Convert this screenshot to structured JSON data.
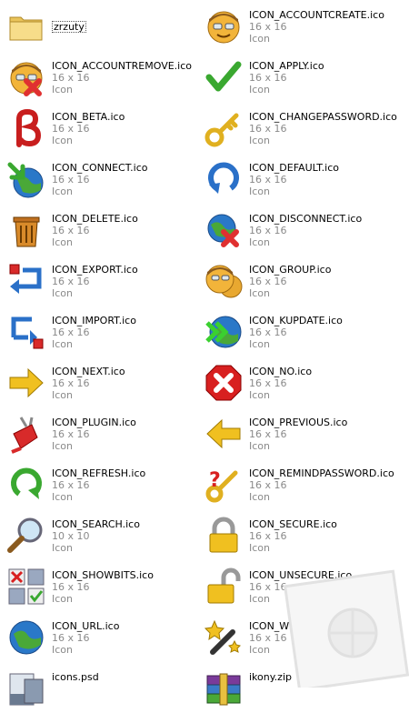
{
  "folder": {
    "name": "zrzuty"
  },
  "items": [
    {
      "name": "ICON_ACCOUNTCREATE.ico",
      "size": "16 x 16",
      "type": "Icon",
      "icon": "account-face-icon"
    },
    {
      "name": "ICON_ACCOUNTREMOVE.ico",
      "size": "16 x 16",
      "type": "Icon",
      "icon": "account-remove-icon"
    },
    {
      "name": "ICON_APPLY.ico",
      "size": "16 x 16",
      "type": "Icon",
      "icon": "checkmark-icon"
    },
    {
      "name": "ICON_BETA.ico",
      "size": "16 x 16",
      "type": "Icon",
      "icon": "beta-icon"
    },
    {
      "name": "ICON_CHANGEPASSWORD.ico",
      "size": "16 x 16",
      "type": "Icon",
      "icon": "key-icon"
    },
    {
      "name": "ICON_CONNECT.ico",
      "size": "16 x 16",
      "type": "Icon",
      "icon": "globe-connect-icon"
    },
    {
      "name": "ICON_DEFAULT.ico",
      "size": "16 x 16",
      "type": "Icon",
      "icon": "circular-arrow-icon"
    },
    {
      "name": "ICON_DELETE.ico",
      "size": "16 x 16",
      "type": "Icon",
      "icon": "trash-can-icon"
    },
    {
      "name": "ICON_DISCONNECT.ico",
      "size": "16 x 16",
      "type": "Icon",
      "icon": "globe-disconnect-icon"
    },
    {
      "name": "ICON_EXPORT.ico",
      "size": "16 x 16",
      "type": "Icon",
      "icon": "export-arrow-icon"
    },
    {
      "name": "ICON_GROUP.ico",
      "size": "16 x 16",
      "type": "Icon",
      "icon": "group-faces-icon"
    },
    {
      "name": "ICON_IMPORT.ico",
      "size": "16 x 16",
      "type": "Icon",
      "icon": "import-arrow-icon"
    },
    {
      "name": "ICON_KUPDATE.ico",
      "size": "16 x 16",
      "type": "Icon",
      "icon": "globe-fast-forward-icon"
    },
    {
      "name": "ICON_NEXT.ico",
      "size": "16 x 16",
      "type": "Icon",
      "icon": "arrow-right-icon"
    },
    {
      "name": "ICON_NO.ico",
      "size": "16 x 16",
      "type": "Icon",
      "icon": "stop-x-icon"
    },
    {
      "name": "ICON_PLUGIN.ico",
      "size": "16 x 16",
      "type": "Icon",
      "icon": "plug-icon"
    },
    {
      "name": "ICON_PREVIOUS.ico",
      "size": "16 x 16",
      "type": "Icon",
      "icon": "arrow-left-icon"
    },
    {
      "name": "ICON_REFRESH.ico",
      "size": "16 x 16",
      "type": "Icon",
      "icon": "refresh-arrow-icon"
    },
    {
      "name": "ICON_REMINDPASSWORD.ico",
      "size": "16 x 16",
      "type": "Icon",
      "icon": "key-question-icon"
    },
    {
      "name": "ICON_SEARCH.ico",
      "size": "10 x 10",
      "type": "Icon",
      "icon": "magnifier-icon"
    },
    {
      "name": "ICON_SECURE.ico",
      "size": "16 x 16",
      "type": "Icon",
      "icon": "padlock-closed-icon"
    },
    {
      "name": "ICON_SHOWBITS.ico",
      "size": "16 x 16",
      "type": "Icon",
      "icon": "bits-grid-icon"
    },
    {
      "name": "ICON_UNSECURE.ico",
      "size": "16 x 16",
      "type": "Icon",
      "icon": "padlock-open-icon"
    },
    {
      "name": "ICON_URL.ico",
      "size": "16 x 16",
      "type": "Icon",
      "icon": "globe-icon"
    },
    {
      "name": "ICON_WIZARD.ico",
      "size": "16 x 16",
      "type": "Icon",
      "icon": "magic-wand-icon"
    },
    {
      "name": "icons.psd",
      "size": "",
      "type": "",
      "icon": "psd-file-icon"
    },
    {
      "name": "ikony.zip",
      "size": "",
      "type": "",
      "icon": "zip-archive-icon"
    }
  ],
  "colors": {
    "meta_text": "#8a8a8a",
    "folder": "#f3d77a"
  }
}
